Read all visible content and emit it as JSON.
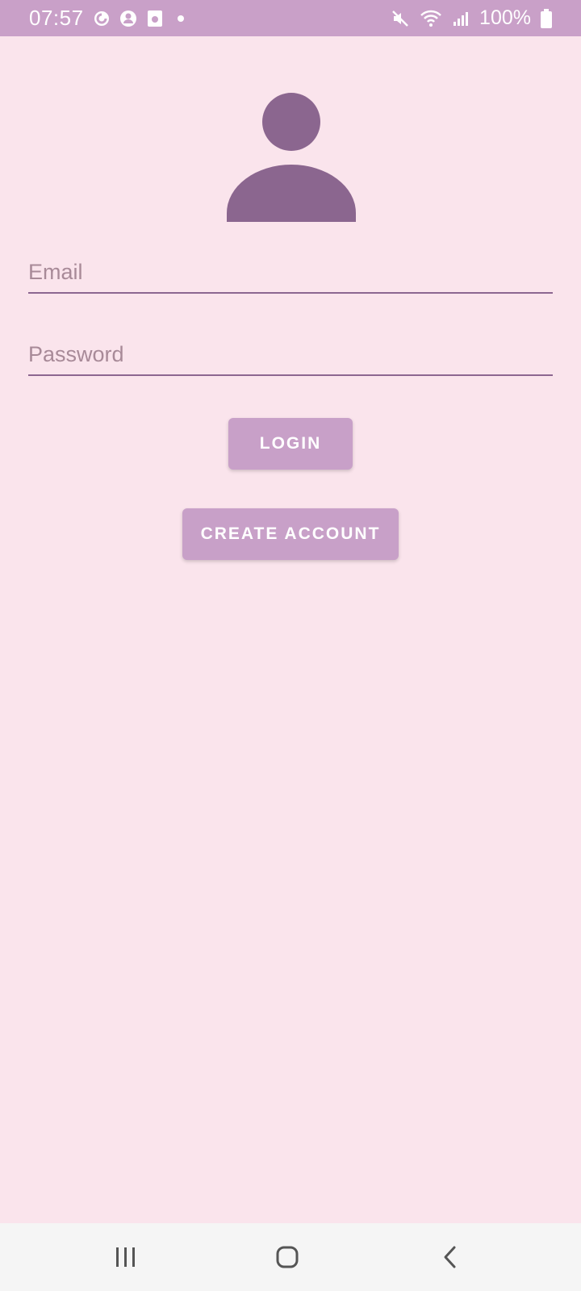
{
  "status_bar": {
    "time": "07:57",
    "battery": "100%",
    "icons": [
      "sync-icon",
      "account-circle-icon",
      "screenshot-icon",
      "notification-dot-icon",
      "mute-icon",
      "wifi-icon",
      "signal-icon",
      "battery-icon"
    ]
  },
  "form": {
    "email_placeholder": "Email",
    "email_value": "",
    "password_placeholder": "Password",
    "password_value": ""
  },
  "buttons": {
    "login_label": "LOGIN",
    "create_account_label": "CREATE ACCOUNT"
  },
  "colors": {
    "background": "#fae4ec",
    "status_bar": "#c9a0c8",
    "accent": "#8b668f",
    "button": "#c8a0c8"
  }
}
